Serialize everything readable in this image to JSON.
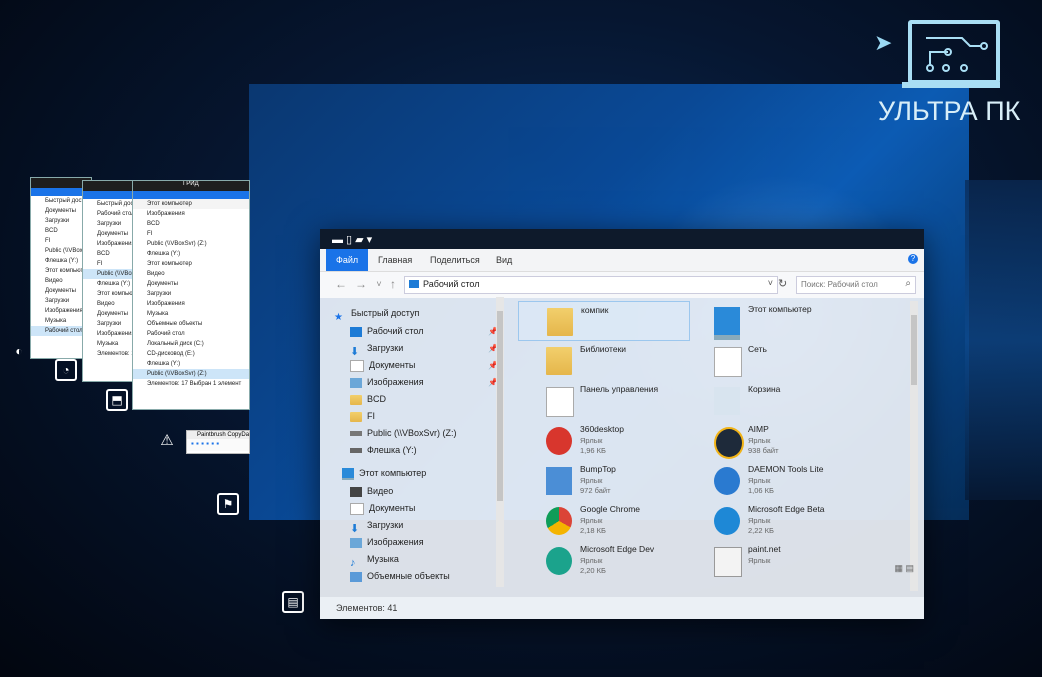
{
  "brand": {
    "logo_text": "УЛЬТРА ПК"
  },
  "mini_windows": {
    "w1": {
      "rows": [
        "Быстрый доступ",
        "Документы",
        "Загрузки",
        "BCD",
        "FI",
        "Public (\\\\VBoxSvr) (Z:)",
        "Флешка (Y:)",
        "Этот компьютер",
        "Видео",
        "Документы",
        "Загрузки",
        "Изображения",
        "Музыка",
        "Рабочий стол"
      ]
    },
    "w2": {
      "rows": [
        "Быстрый доступ",
        "Рабочий стол",
        "Загрузки",
        "Документы",
        "Изображения",
        "BCD",
        "FI",
        "Public (\\\\VBoxSvr)",
        "Флешка (Y:)",
        "Этот компьютер",
        "Видео",
        "Документы",
        "Загрузки",
        "Изображения",
        "Музыка"
      ],
      "status": "Элементов: 10"
    },
    "w3": {
      "title": "ГРИД",
      "address": "Этот компьютер",
      "rows": [
        "Изображения",
        "BCD",
        "FI",
        "Public (\\\\VBoxSvr) (Z:)",
        "Флешка (Y:)",
        "Этот компьютер",
        "Видео",
        "Документы",
        "Загрузки",
        "Изображения",
        "Музыка",
        "Объемные объекты",
        "Рабочий стол",
        "Локальный диск (C:)",
        "CD-дисковод (E:)",
        "Флешка (Y:)",
        "Public (\\\\VBoxSvr) (Z:)"
      ],
      "status": "Элементов: 17   Выбран 1 элемент"
    }
  },
  "tiny_app": {
    "title": "Paintbrush CopyData"
  },
  "explorer": {
    "ribbon_tabs": [
      "Файл",
      "Главная",
      "Поделиться",
      "Вид"
    ],
    "address": "Рабочий стол",
    "search_placeholder": "Поиск: Рабочий стол",
    "nav": {
      "quick_access": "Быстрый доступ",
      "items": [
        {
          "label": "Рабочий стол",
          "pinned": true
        },
        {
          "label": "Загрузки",
          "pinned": true
        },
        {
          "label": "Документы",
          "pinned": true
        },
        {
          "label": "Изображения",
          "pinned": true
        },
        {
          "label": "BCD"
        },
        {
          "label": "FI"
        },
        {
          "label": "Public (\\\\VBoxSvr) (Z:)"
        },
        {
          "label": "Флешка (Y:)"
        }
      ],
      "this_pc": "Этот компьютер",
      "pc_items": [
        "Видео",
        "Документы",
        "Загрузки",
        "Изображения",
        "Музыка",
        "Объемные объекты"
      ]
    },
    "tiles": [
      {
        "name": "компик"
      },
      {
        "name": "Этот компьютер"
      },
      {
        "name": "Библиотеки"
      },
      {
        "name": "Сеть"
      },
      {
        "name": "Панель управления"
      },
      {
        "name": "Корзина"
      },
      {
        "name": "360desktop",
        "type": "Ярлык",
        "size": "1,96 КБ"
      },
      {
        "name": "AIMP",
        "type": "Ярлык",
        "size": "938 байт"
      },
      {
        "name": "BumpTop",
        "type": "Ярлык",
        "size": "972 байт"
      },
      {
        "name": "DAEMON Tools Lite",
        "type": "Ярлык",
        "size": "1,06 КБ"
      },
      {
        "name": "Google Chrome",
        "type": "Ярлык",
        "size": "2,18 КБ"
      },
      {
        "name": "Microsoft Edge Beta",
        "type": "Ярлык",
        "size": "2,22 КБ"
      },
      {
        "name": "Microsoft Edge Dev",
        "type": "Ярлык",
        "size": "2,20 КБ"
      },
      {
        "name": "paint.net",
        "type": "Ярлык",
        "size": ""
      }
    ],
    "status": "Элементов: 41"
  },
  "colors": {
    "accent": "#1a73e8",
    "logo": "#a9def4"
  }
}
